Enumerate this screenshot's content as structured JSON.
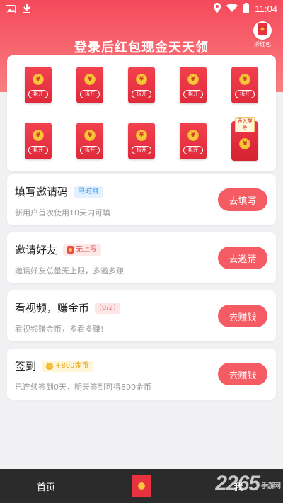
{
  "status_bar": {
    "time": "11:04"
  },
  "header": {
    "title": "登录后红包现金天天领",
    "chai_label": "拆红包"
  },
  "envelopes": {
    "coin_symbol": "¥",
    "open_label": "拆开",
    "special_tag": "表入群等"
  },
  "tasks": [
    {
      "title": "填写邀请码",
      "badge": "限时赚",
      "desc": "新用户首次使用10天内可填",
      "button": "去填写"
    },
    {
      "title": "邀请好友",
      "badge": "无上限",
      "desc": "邀请好友总量无上限，多邀多赚",
      "button": "去邀请"
    },
    {
      "title": "看视频，赚金币",
      "badge": "(0/2)",
      "desc": "看视频赚金币，多看多赚!",
      "button": "去赚钱"
    },
    {
      "title": "签到",
      "badge": "+800金币",
      "desc": "已连续签到0天，明天签到可得800金币",
      "button": "去赚钱"
    }
  ],
  "tabbar": {
    "home": "首页",
    "me": "我"
  },
  "watermark": {
    "brand": "2265",
    "sub": "手游网"
  },
  "colors": {
    "accent": "#f45b62",
    "header": "#f54a5b",
    "tabbar": "#2b2b2b"
  }
}
